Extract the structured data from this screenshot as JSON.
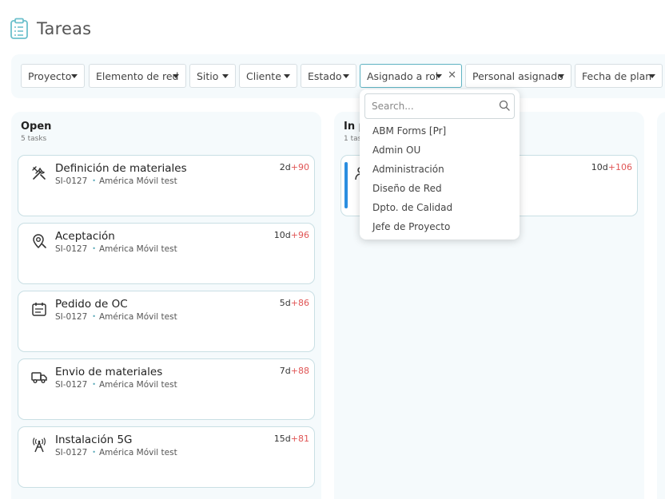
{
  "page": {
    "title": "Tareas",
    "icon": "clipboard-list-icon"
  },
  "filters": [
    {
      "label": "Proyecto"
    },
    {
      "label": "Elemento de red"
    },
    {
      "label": "Sitio"
    },
    {
      "label": "Cliente"
    },
    {
      "label": "Estado"
    },
    {
      "label": "Asignado a rol",
      "active": true
    },
    {
      "label": "Personal asignado"
    },
    {
      "label": "Fecha de plan"
    }
  ],
  "dropdown": {
    "search_placeholder": "Search...",
    "options": [
      "ABM Forms [Pr]",
      "Admin OU",
      "Administración",
      "Diseño de Red",
      "Dpto. de Calidad",
      "Jefe de Proyecto"
    ]
  },
  "columns": [
    {
      "title": "Open",
      "count": "5 tasks",
      "cards": [
        {
          "icon": "tools-icon",
          "title": "Definición de materiales",
          "code": "SI-0127",
          "client": "América Móvil test",
          "days": "2d",
          "overdue": "+90"
        },
        {
          "icon": "location-search-icon",
          "title": "Aceptación",
          "code": "SI-0127",
          "client": "América Móvil test",
          "days": "10d",
          "overdue": "+96"
        },
        {
          "icon": "calendar-icon",
          "title": "Pedido de OC",
          "code": "SI-0127",
          "client": "América Móvil test",
          "days": "5d",
          "overdue": "+86"
        },
        {
          "icon": "truck-icon",
          "title": "Envio de materiales",
          "code": "SI-0127",
          "client": "América Móvil test",
          "days": "7d",
          "overdue": "+88"
        },
        {
          "icon": "antenna-icon",
          "title": "Instalación 5G",
          "code": "SI-0127",
          "client": "América Móvil test",
          "days": "15d",
          "overdue": "+81"
        }
      ]
    },
    {
      "title": "In p",
      "count": "1 tas",
      "cards": [
        {
          "icon": "task-icon",
          "days": "10d",
          "overdue": "+106"
        }
      ]
    }
  ],
  "colors": {
    "accent": "#5fb3c2",
    "overdue": "#e05555",
    "progress_bar": "#2a8ee0",
    "panel_bg": "#f5fafc"
  }
}
